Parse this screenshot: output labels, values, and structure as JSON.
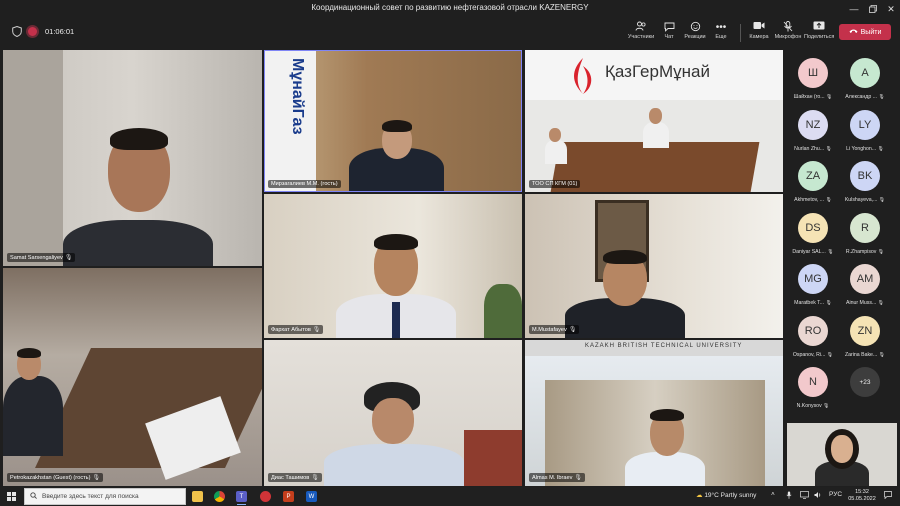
{
  "window": {
    "title": "Координационный совет по развитию нефтегазовой отрасли KAZENERGY"
  },
  "toolbar": {
    "timer": "01:06:01",
    "participants": "Участники",
    "chat": "Чат",
    "reactions": "Реакции",
    "more": "Еще",
    "camera": "Камера",
    "mic": "Микрофон",
    "share": "Поделиться",
    "leave": "Выйти"
  },
  "tiles": {
    "samat": "Samat Sarsengaliyev",
    "mirzagaliyev": "Мирзагалиев М.М. (гость)",
    "too": "ТОО СП КГМ (01)",
    "petrokaz": "Petrokazakhstan (Guest) (гость)",
    "farkhat": "Фархат Абытов",
    "mustafayev": "M.Mustafayev",
    "dias": "Диас Ташимов",
    "almas": "Almas M. Ibraev",
    "logo_text": "ҚазГерМұнай",
    "university_text": "KAZAKH BRITISH TECHNICAL UNIVERSITY",
    "munay_text": "МұнайГаз"
  },
  "roster": [
    {
      "initials": "Ш",
      "name": "Шайхан (го...",
      "color": "#f2c9cc"
    },
    {
      "initials": "A",
      "name": "Александр ...",
      "color": "#c6e8d0"
    },
    {
      "initials": "NZ",
      "name": "Nurlan Zhu...",
      "color": "#dcdcf2"
    },
    {
      "initials": "LY",
      "name": "Li Yonghon...",
      "color": "#cdd6f5"
    },
    {
      "initials": "ZA",
      "name": "Akhmetov, ...",
      "color": "#c6e8d0"
    },
    {
      "initials": "BK",
      "name": "Kulshayeva,...",
      "color": "#cdd6f5"
    },
    {
      "initials": "DS",
      "name": "Daniyar SAL...",
      "color": "#f5e3b5"
    },
    {
      "initials": "R",
      "name": "R.Zhampisov",
      "color": "#d7e6d0"
    },
    {
      "initials": "MG",
      "name": "Maratbek T...",
      "color": "#cdd6f5"
    },
    {
      "initials": "AM",
      "name": "Ainur Muss...",
      "color": "#ead7d2"
    },
    {
      "initials": "RO",
      "name": "Ospanov, Ri...",
      "color": "#ead7d2"
    },
    {
      "initials": "ZN",
      "name": "Zarina Bake...",
      "color": "#f5e3b5"
    },
    {
      "initials": "N",
      "name": "N.Konysov",
      "color": "#f2c9cc"
    }
  ],
  "roster_more": "+23",
  "taskbar": {
    "search_placeholder": "Введите здесь текст для поиска",
    "weather": "19°C  Partly sunny",
    "lang": "РУС",
    "time": "15:32",
    "date": "05.05.2022"
  }
}
